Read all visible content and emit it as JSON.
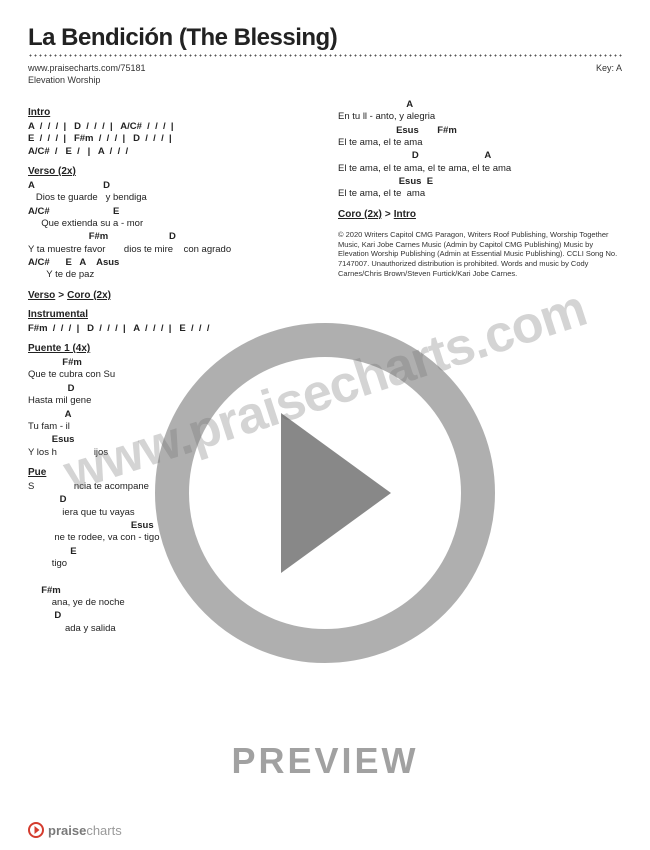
{
  "title": "La Bendición (The Blessing)",
  "url": "www.praisecharts.com/75181",
  "key_label": "Key: A",
  "artist": "Elevation Worship",
  "watermark": "www.praisecharts.com",
  "preview": "PREVIEW",
  "logo": {
    "bold": "praise",
    "rest": "charts"
  },
  "sections": {
    "intro": {
      "label": "Intro",
      "lines": [
        "A  /  /  /  |   D  /  /  /  |   A/C#  /  /  /  |",
        "E  /  /  /  |   F#m  /  /  /  |   D  /  /  /  |",
        "A/C#  /   E  /   |   A  /  /  /"
      ]
    },
    "verso": {
      "label": "Verso (2x)",
      "pairs": [
        {
          "chords": "A                          D",
          "lyric": "   Dios te guarde   y bendiga"
        },
        {
          "chords": "A/C#                        E",
          "lyric": "     Que extienda su a - mor"
        },
        {
          "chords": "                       F#m                       D",
          "lyric": "Y ta muestre favor       dios te mire    con agrado"
        },
        {
          "chords": "A/C#      E   A    Asus",
          "lyric": "       Y te de paz"
        }
      ]
    },
    "nav1": {
      "a": "Verso",
      "b": "Coro (2x)"
    },
    "instrumental": {
      "label": "Instrumental",
      "line": "F#m  /  /  /  |   D  /  /  /  |   A  /  /  /  |   E  /  /  /"
    },
    "puente1": {
      "label": "Puente 1 (4x)",
      "pairs": [
        {
          "chords": "             F#m",
          "lyric": "Que te cubra con Su"
        },
        {
          "chords": "               D",
          "lyric": "Hasta mil gene"
        },
        {
          "chords": "              A",
          "lyric": "Tu fam - il"
        },
        {
          "chords": "         Esus",
          "lyric": "Y los h              ijos"
        }
      ]
    },
    "puente2": {
      "label": "Pue",
      "pairs": [
        {
          "chords": "",
          "lyric": "S               ncia te acompane"
        },
        {
          "chords": "            D",
          "lyric": "             iera que tu vayas"
        },
        {
          "chords": "                                       Esus",
          "lyric": "          ne te rodee, va con - tigo"
        },
        {
          "chords": "                E",
          "lyric": "         tigo"
        },
        {
          "chords": "",
          "lyric": ""
        },
        {
          "chords": "     F#m",
          "lyric": "         ana, ye de noche"
        },
        {
          "chords": "          D",
          "lyric": "              ada y salida"
        }
      ]
    },
    "right_block": {
      "pairs": [
        {
          "chords": "                          A",
          "lyric": "En tu ll - anto, y alegria"
        },
        {
          "chords": "                      Esus       F#m",
          "lyric": "El te ama, el te ama"
        },
        {
          "chords": "                            D                         A",
          "lyric": "El te ama, el te ama, el te ama, el te ama"
        },
        {
          "chords": "                       Esus  E",
          "lyric": "El te ama, el te  ama"
        }
      ]
    },
    "nav2": {
      "a": "Coro (2x)",
      "b": "Intro"
    },
    "copyright": "© 2020 Writers Capitol CMG Paragon, Writers Roof Publishing, Worship Together Music, Kari Jobe Carnes Music (Admin by Capitol CMG Publishing) Music by Elevation Worship Publishing (Admin at Essential Music Publishing). CCLI Song No. 7147007. Unauthorized distribution is prohibited. Words and music by Cody Carnes/Chris Brown/Steven Furtick/Kari Jobe Carnes."
  }
}
